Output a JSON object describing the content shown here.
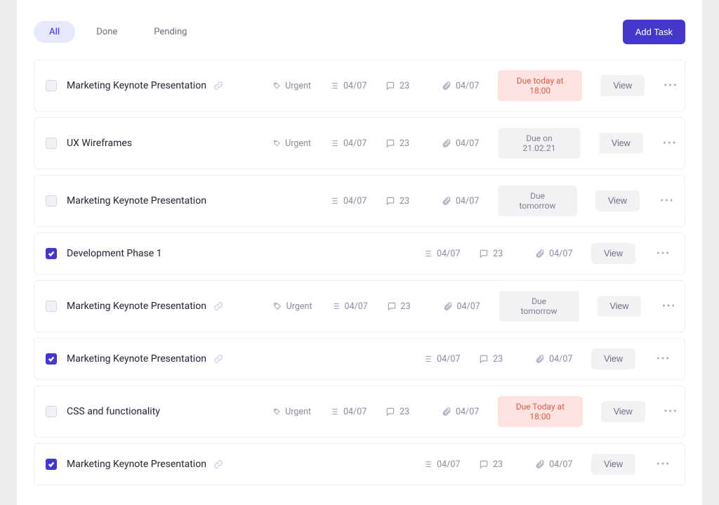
{
  "tabs": {
    "all": "All",
    "done": "Done",
    "pending": "Pending"
  },
  "add_task": "Add Task",
  "view_label": "View",
  "urgent_label": "Urgent",
  "tasks": [
    {
      "title": "Marketing Keynote Presentation",
      "checked": false,
      "link": true,
      "tag": true,
      "list_date": "04/07",
      "comments": "23",
      "attach_date": "04/07",
      "due": "Due today at 18:00",
      "due_style": "urgent",
      "shifted": false
    },
    {
      "title": "UX Wireframes",
      "checked": false,
      "link": false,
      "tag": true,
      "list_date": "04/07",
      "comments": "23",
      "attach_date": "04/07",
      "due": "Due on 21.02.21",
      "due_style": "normal",
      "shifted": false
    },
    {
      "title": "Marketing Keynote Presentation",
      "checked": false,
      "link": false,
      "tag": false,
      "list_date": "04/07",
      "comments": "23",
      "attach_date": "04/07",
      "due": "Due tomorrow",
      "due_style": "normal",
      "shifted": false
    },
    {
      "title": "Development Phase 1",
      "checked": true,
      "link": false,
      "tag": false,
      "list_date": "04/07",
      "comments": "23",
      "attach_date": "04/07",
      "due": "",
      "due_style": "",
      "shifted": true
    },
    {
      "title": "Marketing Keynote Presentation",
      "checked": false,
      "link": true,
      "tag": true,
      "list_date": "04/07",
      "comments": "23",
      "attach_date": "04/07",
      "due": "Due tomorrow",
      "due_style": "normal",
      "shifted": false
    },
    {
      "title": "Marketing Keynote Presentation",
      "checked": true,
      "link": true,
      "tag": false,
      "list_date": "04/07",
      "comments": "23",
      "attach_date": "04/07",
      "due": "",
      "due_style": "",
      "shifted": true
    },
    {
      "title": "CSS and functionality",
      "checked": false,
      "link": false,
      "tag": true,
      "list_date": "04/07",
      "comments": "23",
      "attach_date": "04/07",
      "due": "Due Today at 18:00",
      "due_style": "urgent",
      "shifted": false
    },
    {
      "title": "Marketing Keynote Presentation",
      "checked": true,
      "link": true,
      "tag": true,
      "list_date": "04/07",
      "comments": "23",
      "attach_date": "04/07",
      "due": "",
      "due_style": "",
      "shifted": true
    }
  ]
}
